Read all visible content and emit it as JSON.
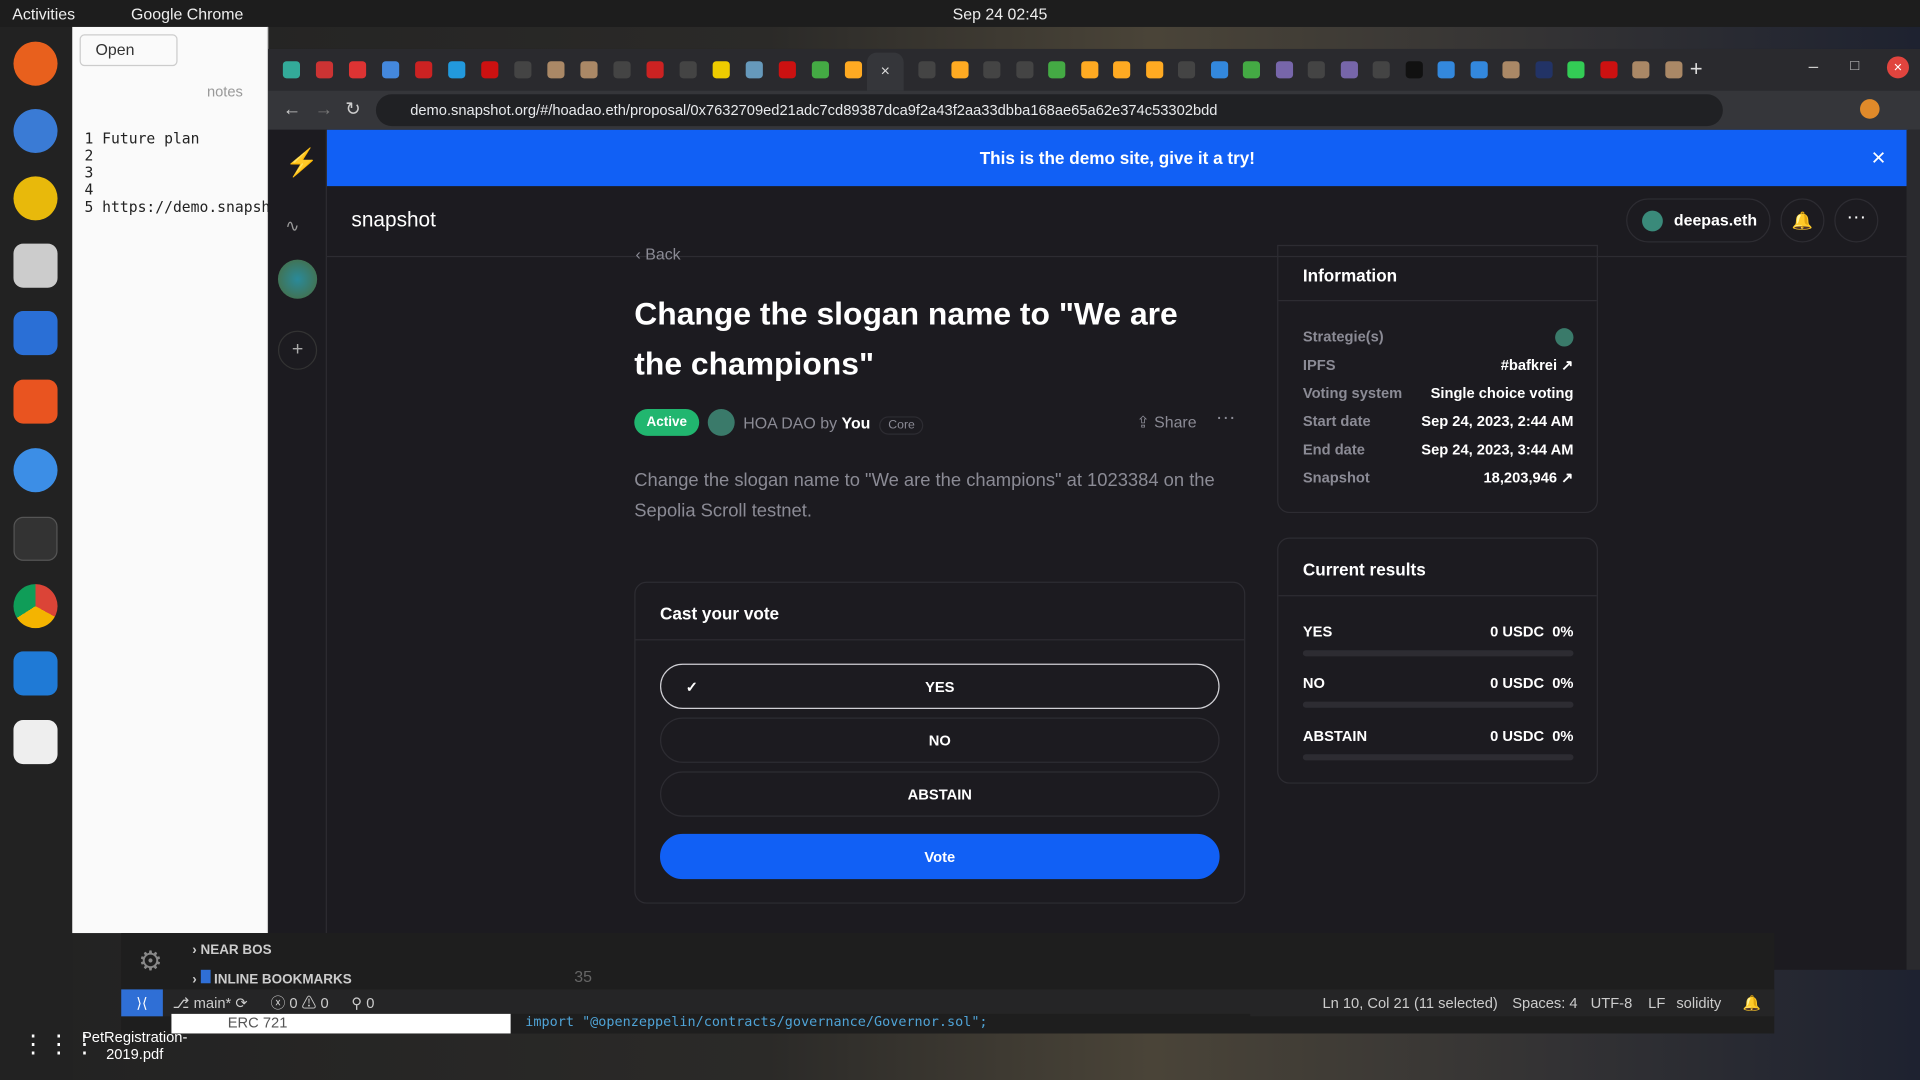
{
  "topbar": {
    "activities": "Activities",
    "app": "Google Chrome",
    "clock": "Sep 24  02:45"
  },
  "notes": {
    "title": "notes",
    "open": "Open",
    "lines": [
      "1 Future plan",
      "2",
      "3",
      "4",
      "5 https://demo.snapsh"
    ]
  },
  "browser": {
    "url": "demo.snapshot.org/#/hoadao.eth/proposal/0x7632709ed21adc7cd89387dca9f2a43f2aa33dbba168ae65a62e374c53302bdd",
    "active_tab_close": "×"
  },
  "banner": {
    "text": "This is the demo site, give it a try!"
  },
  "header": {
    "brand": "snapshot",
    "user": "deepas.eth"
  },
  "proposal": {
    "back": "Back",
    "title": "Change the slogan name to \"We are the champions\"",
    "status": "Active",
    "space": "HOA DAO",
    "by": "by",
    "author": "You",
    "author_badge": "Core",
    "share": "Share",
    "body": "Change the slogan name to \"We are the champions\" at 1023384 on the Sepolia Scroll testnet."
  },
  "vote": {
    "title": "Cast your vote",
    "options": [
      "YES",
      "NO",
      "ABSTAIN"
    ],
    "selected": "YES",
    "button": "Vote"
  },
  "information": {
    "title": "Information",
    "rows": [
      {
        "label": "Strategie(s)",
        "value": ""
      },
      {
        "label": "IPFS",
        "value": "#bafkrei"
      },
      {
        "label": "Voting system",
        "value": "Single choice voting"
      },
      {
        "label": "Start date",
        "value": "Sep 24, 2023, 2:44 AM"
      },
      {
        "label": "End date",
        "value": "Sep 24, 2023, 3:44 AM"
      },
      {
        "label": "Snapshot",
        "value": "18,203,946"
      }
    ]
  },
  "results": {
    "title": "Current results",
    "rows": [
      {
        "label": "YES",
        "amount": "0 USDC",
        "percent": "0%",
        "fill": 0
      },
      {
        "label": "NO",
        "amount": "0 USDC",
        "percent": "0%",
        "fill": 0
      },
      {
        "label": "ABSTAIN",
        "amount": "0 USDC",
        "percent": "0%",
        "fill": 0
      }
    ]
  },
  "vscode": {
    "tree": [
      "NEAR BOS",
      "INLINE BOOKMARKS"
    ],
    "line_no": "35",
    "branch": "main*",
    "errors": "0",
    "warnings": "0",
    "ports": "0",
    "cursor": "Ln 10, Col 21 (11 selected)",
    "spaces": "Spaces: 4",
    "encoding": "UTF-8",
    "eol": "LF",
    "lang": "solidity",
    "code": "import \"@openzeppelin/contracts/governance/Governor.sol\";",
    "erc": "ERC 721"
  },
  "desktop": {
    "file": "PetRegistration-2019.pdf"
  },
  "colors": {
    "accent": "#1160f5",
    "active": "#21b66f",
    "bg": "#1c1b20",
    "border": "#2d2c32"
  }
}
